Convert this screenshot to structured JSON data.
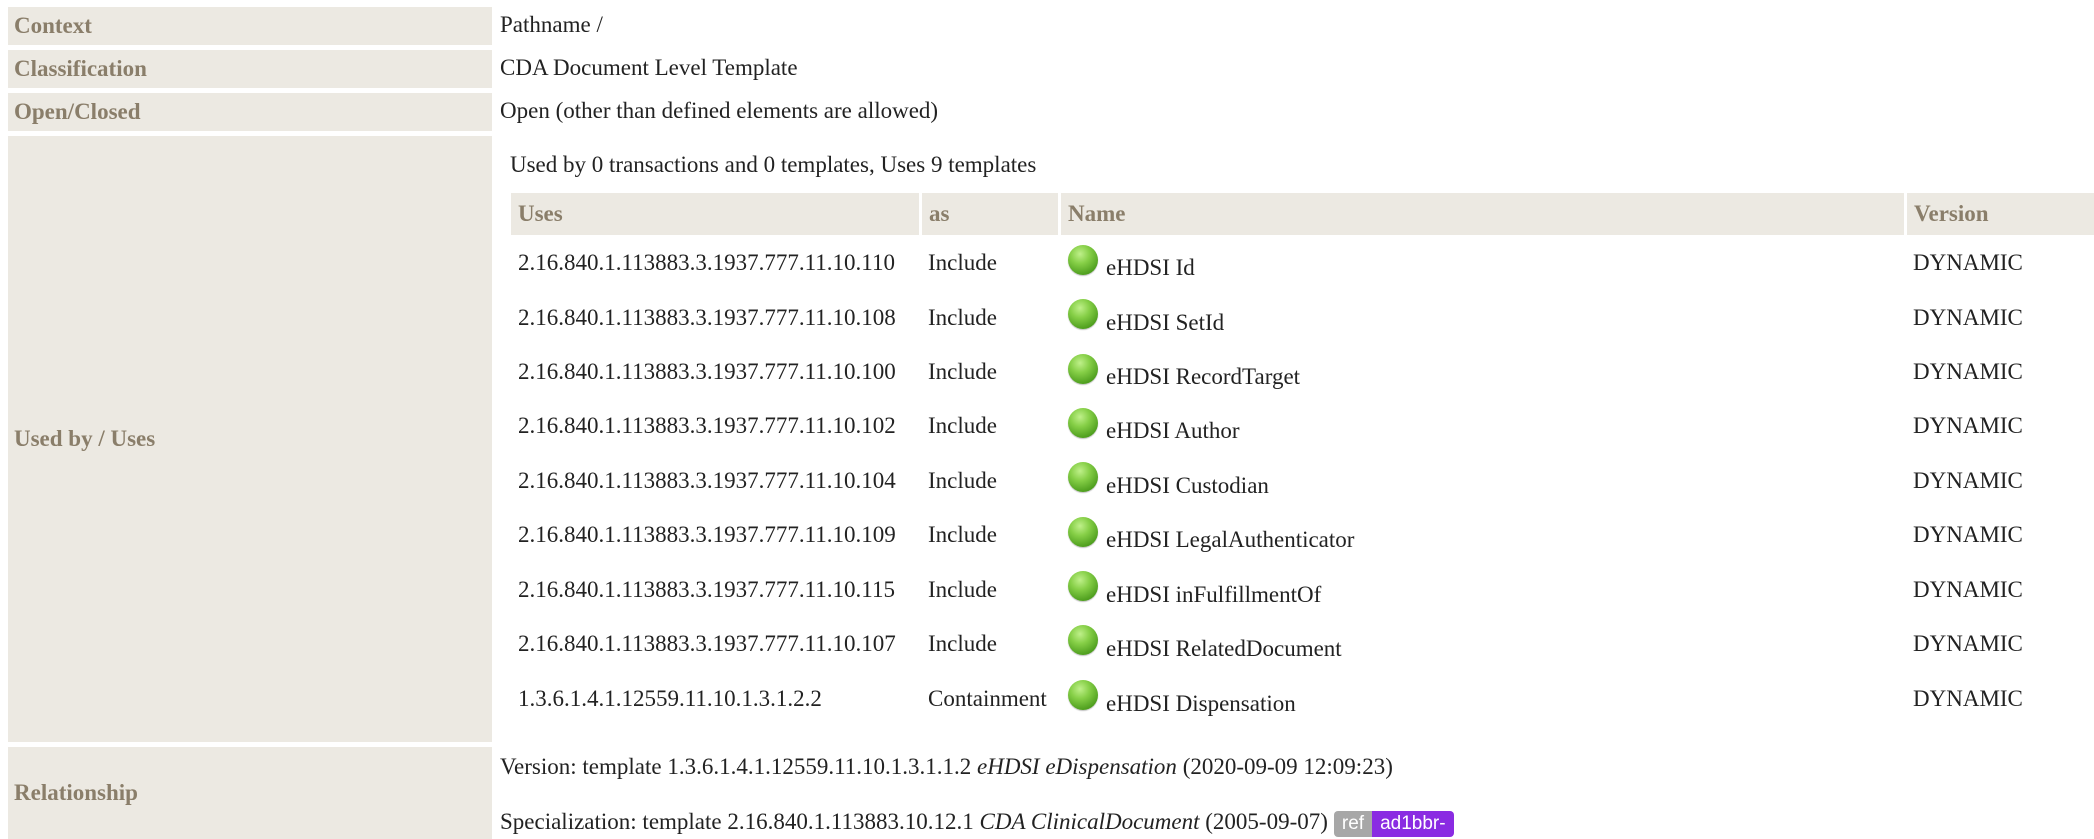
{
  "rows": {
    "context": {
      "label": "Context",
      "value": "Pathname /"
    },
    "classification": {
      "label": "Classification",
      "value": "CDA Document Level Template"
    },
    "open_closed": {
      "label": "Open/Closed",
      "value": "Open (other than defined elements are allowed)"
    },
    "used_by": {
      "label": "Used by / Uses",
      "summary": "Used by 0 transactions and 0 templates, Uses 9 templates"
    },
    "relationship": {
      "label": "Relationship"
    }
  },
  "uses_table": {
    "headers": {
      "uses": "Uses",
      "as": "as",
      "name": "Name",
      "version": "Version"
    },
    "rows": [
      {
        "uses": "2.16.840.1.113883.3.1937.777.11.10.110",
        "as": "Include",
        "icon": "green-ball-icon",
        "name": "eHDSI Id",
        "version": "DYNAMIC"
      },
      {
        "uses": "2.16.840.1.113883.3.1937.777.11.10.108",
        "as": "Include",
        "icon": "green-ball-icon",
        "name": "eHDSI SetId",
        "version": "DYNAMIC"
      },
      {
        "uses": "2.16.840.1.113883.3.1937.777.11.10.100",
        "as": "Include",
        "icon": "green-ball-icon",
        "name": "eHDSI RecordTarget",
        "version": "DYNAMIC"
      },
      {
        "uses": "2.16.840.1.113883.3.1937.777.11.10.102",
        "as": "Include",
        "icon": "green-ball-icon",
        "name": "eHDSI Author",
        "version": "DYNAMIC"
      },
      {
        "uses": "2.16.840.1.113883.3.1937.777.11.10.104",
        "as": "Include",
        "icon": "green-ball-icon",
        "name": "eHDSI Custodian",
        "version": "DYNAMIC"
      },
      {
        "uses": "2.16.840.1.113883.3.1937.777.11.10.109",
        "as": "Include",
        "icon": "green-ball-icon",
        "name": "eHDSI LegalAuthenticator",
        "version": "DYNAMIC"
      },
      {
        "uses": "2.16.840.1.113883.3.1937.777.11.10.115",
        "as": "Include",
        "icon": "green-ball-icon",
        "name": "eHDSI inFulfillmentOf",
        "version": "DYNAMIC"
      },
      {
        "uses": "2.16.840.1.113883.3.1937.777.11.10.107",
        "as": "Include",
        "icon": "green-ball-icon",
        "name": "eHDSI RelatedDocument",
        "version": "DYNAMIC"
      },
      {
        "uses": "1.3.6.1.4.1.12559.11.10.1.3.1.2.2",
        "as": "Containment",
        "icon": "green-ball-icon",
        "name": "eHDSI Dispensation",
        "version": "DYNAMIC"
      }
    ]
  },
  "relationship": {
    "version": {
      "prefix": "Version: template 1.3.6.1.4.1.12559.11.10.1.3.1.1.2",
      "name": "eHDSI eDispensation",
      "suffix": "(2020-09-09 12:09:23)"
    },
    "specialization": {
      "prefix": "Specialization: template 2.16.840.1.113883.10.12.1",
      "name": "CDA ClinicalDocument",
      "suffix": "(2005-09-07)",
      "badge_ref": "ref",
      "badge_rel": "ad1bbr-"
    }
  },
  "colors": {
    "label_bg": "#ece9e2",
    "label_text": "#8a7e6a",
    "ball": "#6dbb35",
    "badge_ref": "#a7a7a7",
    "badge_rel": "#8a2be2"
  }
}
